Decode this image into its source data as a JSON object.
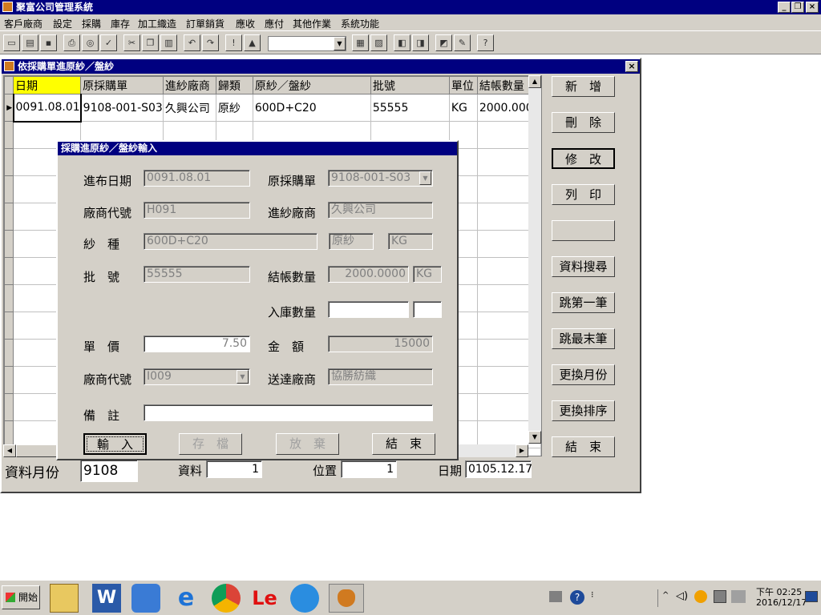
{
  "app": {
    "title": "聚富公司管理系統"
  },
  "menu": [
    "客戶廠商",
    "設定",
    "採購",
    "庫存",
    "加工織造",
    "訂單銷貨",
    "應收",
    "應付",
    "其他作業",
    "系統功能"
  ],
  "toolbar": {
    "help": "?"
  },
  "child": {
    "title": "依採購單進原紗／盤紗"
  },
  "grid": {
    "headers": [
      "日期",
      "原採購單",
      "進紗廠商",
      "歸類",
      "原紗／盤紗",
      "批號",
      "單位",
      "結帳數量"
    ],
    "rows": [
      [
        "0091.08.01",
        "9108-001-S03",
        "久興公司",
        "原紗",
        "600D+C20",
        "55555",
        "KG",
        "2000.0000"
      ]
    ]
  },
  "right_buttons": [
    "新　增",
    "刪　除",
    "修　改",
    "列　印",
    "",
    "資料搜尋",
    "跳第一筆",
    "跳最末筆",
    "更換月份",
    "更換排序",
    "結　束"
  ],
  "status": {
    "month_label": "資料月份",
    "month_value": "9108",
    "records_label": "資料",
    "records_value": "1",
    "position_label": "位置",
    "position_value": "1",
    "date_label": "日期",
    "date_value": "0105.12.17"
  },
  "dialog": {
    "title": "採購進原紗／盤紗輸入",
    "labels": {
      "inbound_date": "進布日期",
      "orig_po": "原採購單",
      "vendor_code": "廠商代號",
      "yarn_vendor": "進紗廠商",
      "yarn_type": "紗　種",
      "lot": "批　號",
      "settle_qty": "結帳數量",
      "stock_qty": "入庫數量",
      "unit_price": "單　價",
      "amount": "金　額",
      "vendor_code2": "廠商代號",
      "delivery_vendor": "送達廠商",
      "remark": "備　註"
    },
    "values": {
      "inbound_date": "0091.08.01",
      "orig_po": "9108-001-S03",
      "vendor_code": "H091",
      "yarn_vendor": "久興公司",
      "yarn_type": "600D+C20",
      "category": "原紗",
      "unit": "KG",
      "lot": "55555",
      "settle_qty": "2000.0000",
      "settle_unit": "KG",
      "stock_qty": "",
      "stock_unit": "",
      "unit_price": "7.50",
      "amount": "15000",
      "vendor_code2": "I009",
      "delivery_vendor": "協勝紡織",
      "remark": ""
    },
    "buttons": [
      "輸　入",
      "存　檔",
      "放　棄",
      "結　束"
    ]
  },
  "taskbar": {
    "start": "開始",
    "time": "下午 02:25",
    "date": "2016/12/17",
    "le": "Le"
  }
}
